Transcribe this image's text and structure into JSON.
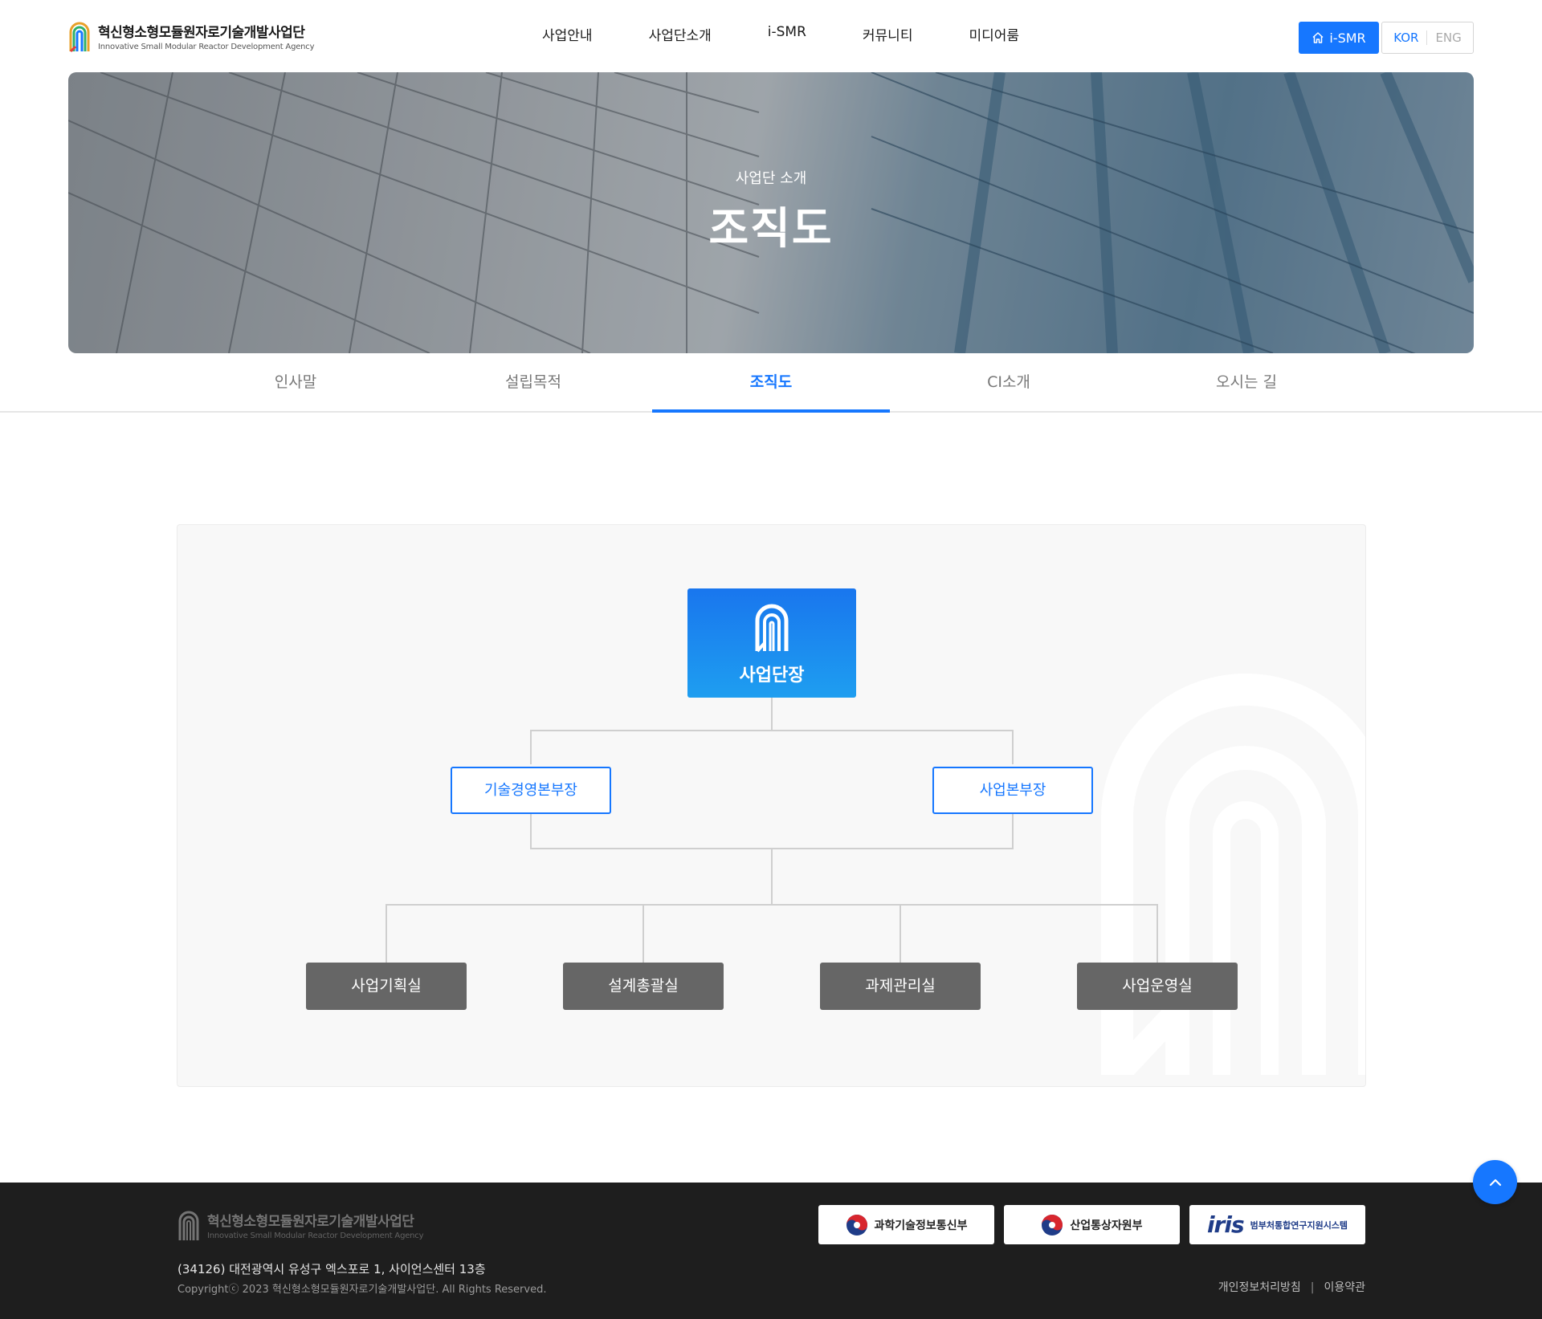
{
  "header": {
    "logo_kor": "혁신형소형모듈원자로기술개발사업단",
    "logo_eng": "Innovative Small Modular Reactor Development Agency",
    "nav": [
      "사업안내",
      "사업단소개",
      "i-SMR",
      "커뮤니티",
      "미디어룸"
    ],
    "ismr_button": "i-SMR",
    "lang_kor": "KOR",
    "lang_eng": "ENG"
  },
  "hero": {
    "subtitle": "사업단 소개",
    "title": "조직도"
  },
  "tabs": [
    {
      "label": "인사말",
      "active": false
    },
    {
      "label": "설립목적",
      "active": false
    },
    {
      "label": "조직도",
      "active": true
    },
    {
      "label": "CI소개",
      "active": false
    },
    {
      "label": "오시는 길",
      "active": false
    }
  ],
  "org": {
    "head": "사업단장",
    "divisions": [
      "기술경영본부장",
      "사업본부장"
    ],
    "offices": [
      "사업기획실",
      "설계총괄실",
      "과제관리실",
      "사업운영실"
    ]
  },
  "footer": {
    "logo_kor": "혁신형소형모듈원자로기술개발사업단",
    "logo_eng": "Innovative Small Modular Reactor Development Agency",
    "address": "(34126) 대전광역시 유성구 엑스포로 1, 사이언스센터 13층",
    "copyright": "Copyrightⓒ 2023 혁신형소형모듈원자로기술개발사업단. All Rights Reserved.",
    "family_sites": [
      "과학기술정보통신부",
      "산업통상자원부"
    ],
    "iris_word": "iris",
    "iris_sub": "범부처통합연구지원시스템",
    "links": [
      "개인정보처리방침",
      "이용약관"
    ]
  },
  "colors": {
    "accent": "#1677ff",
    "office_bg": "#666666",
    "footer_bg": "#1e1e1e"
  }
}
